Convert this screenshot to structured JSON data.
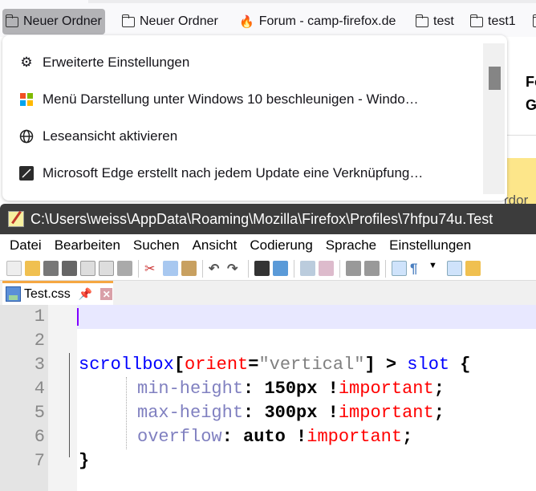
{
  "bookmarks": [
    {
      "label": "Neuer Ordner",
      "icon": "folder-icon",
      "active": true
    },
    {
      "label": "Neuer Ordner",
      "icon": "folder-icon"
    },
    {
      "label": "Forum - camp-firefox.de",
      "icon": "fire-icon"
    },
    {
      "label": "test",
      "icon": "folder-icon"
    },
    {
      "label": "test1",
      "icon": "folder-icon"
    }
  ],
  "background_page": {
    "line1": "Fo",
    "line2": "G",
    "line3": "rdor"
  },
  "dropdown": {
    "items": [
      {
        "label": "Erweiterte Einstellungen",
        "icon": "gear-icon"
      },
      {
        "label": "Menü Darstellung unter Windows 10 beschleunigen - Windo…",
        "icon": "windows-icon"
      },
      {
        "label": "Leseansicht aktivieren",
        "icon": "globe-icon"
      },
      {
        "label": "Microsoft Edge erstellt nach jedem Update eine Verknüpfung…",
        "icon": "edge-icon"
      }
    ]
  },
  "editor_window": {
    "title": "C:\\Users\\weiss\\AppData\\Roaming\\Mozilla\\Firefox\\Profiles\\7hfpu74u.Test",
    "menu": [
      "Datei",
      "Bearbeiten",
      "Suchen",
      "Ansicht",
      "Codierung",
      "Sprache",
      "Einstellungen"
    ],
    "tab": {
      "label": "Test.css"
    },
    "lines": [
      {
        "n": "1"
      },
      {
        "n": "2"
      },
      {
        "n": "3",
        "sel": "scrollbox",
        "b1": "[",
        "att": "orient",
        "eq": "=",
        "str": "\"vertical\"",
        "b2": "]",
        "rest": " > ",
        "sel2": "slot",
        "brace": " {"
      },
      {
        "n": "4",
        "prop": "min-height",
        "colon": ": ",
        "val": "150px",
        "bang": " !",
        "imp": "important",
        "semi": ";"
      },
      {
        "n": "5",
        "prop": "max-height",
        "colon": ": ",
        "val": "300px",
        "bang": " !",
        "imp": "important",
        "semi": ";"
      },
      {
        "n": "6",
        "prop": "overflow",
        "colon": ": ",
        "val": "auto",
        "bang": " !",
        "imp": "important",
        "semi": ";"
      },
      {
        "n": "7",
        "brace": "}"
      }
    ]
  }
}
